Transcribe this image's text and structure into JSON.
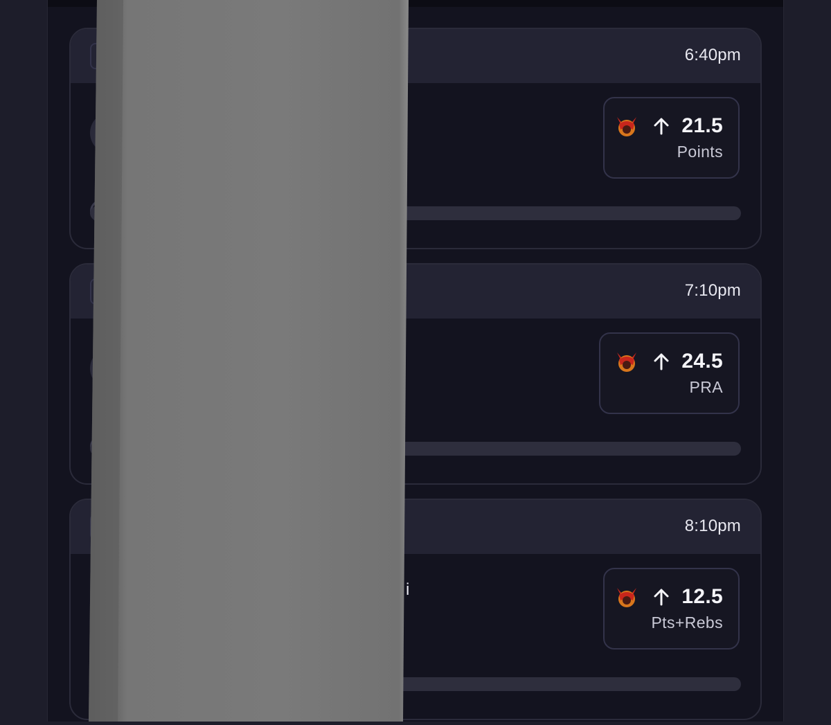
{
  "cards": [
    {
      "time": "6:40pm",
      "pick": {
        "icon": "devil-icon",
        "direction": "arrow-up-icon",
        "value": "21.5",
        "stat": "Points"
      }
    },
    {
      "time": "7:10pm",
      "pick": {
        "icon": "devil-icon",
        "direction": "arrow-up-icon",
        "value": "24.5",
        "stat": "PRA"
      }
    },
    {
      "time": "8:10pm",
      "partial_text": "i",
      "pick": {
        "icon": "devil-icon",
        "direction": "arrow-up-icon",
        "value": "12.5",
        "stat": "Pts+Rebs"
      }
    }
  ],
  "colors": {
    "background": "#13131f",
    "card_header": "#232333",
    "border": "#2b2b3a",
    "text_primary": "#f4f4f8",
    "text_secondary": "#c9c9d6",
    "devil_red": "#c8261c",
    "occluder_gray": "#747474"
  }
}
